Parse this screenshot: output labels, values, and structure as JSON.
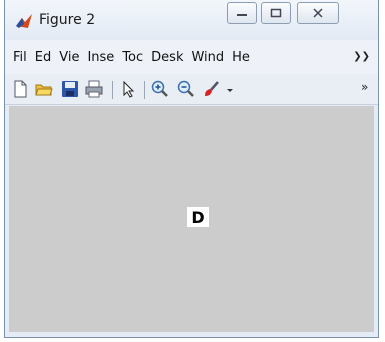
{
  "window": {
    "title": "Figure 2",
    "controls": {
      "minimize": "—",
      "maximize": "☐",
      "close": "☒"
    }
  },
  "menubar": {
    "items": [
      "Fil",
      "Ed",
      "Vie",
      "Inse",
      "Toc",
      "Desk",
      "Wind",
      "He"
    ],
    "overflow": "❯❯"
  },
  "toolbar": {
    "icons": [
      "new-file-icon",
      "open-folder-icon",
      "save-icon",
      "print-icon",
      "pointer-icon",
      "zoom-in-icon",
      "zoom-out-icon",
      "brush-icon"
    ],
    "overflow": "»"
  },
  "figure": {
    "canvas_text": "D",
    "background": "#cccccc"
  }
}
